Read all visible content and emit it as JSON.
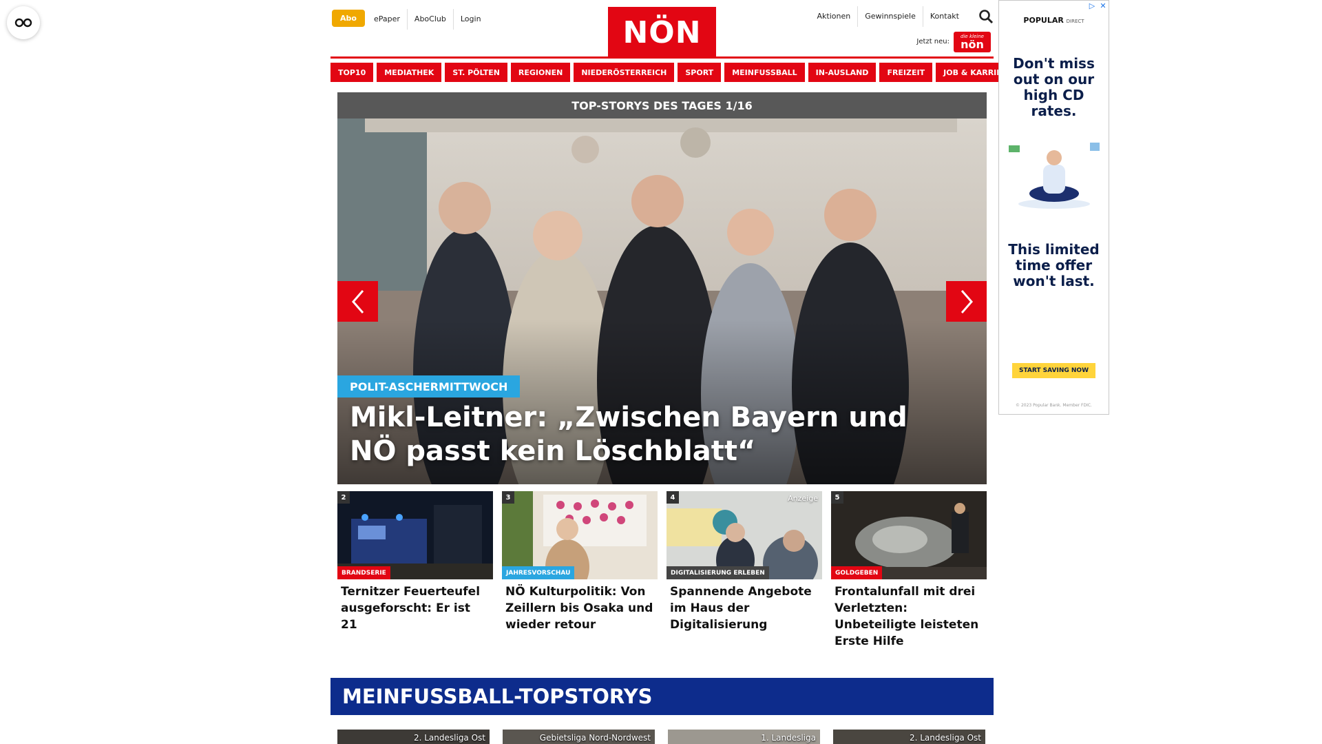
{
  "header": {
    "abo_label": "Abo",
    "left_links": [
      "ePaper",
      "AboClub",
      "Login"
    ],
    "logo_text": "NÖN",
    "right_links": [
      "Aktionen",
      "Gewinnspiele",
      "Kontakt"
    ],
    "jetzt_neu": "Jetzt neu:",
    "badge_small": "die kleine",
    "badge_big": "nön"
  },
  "nav": [
    "TOP10",
    "MEDIATHEK",
    "ST. PÖLTEN",
    "REGIONEN",
    "NIEDERÖSTERREICH",
    "SPORT",
    "MEINFUSSBALL",
    "IN-AUSLAND",
    "FREIZEIT",
    "JOB & KARRIERE"
  ],
  "hero": {
    "bar_title": "TOP-STORYS DES TAGES 1/16",
    "kicker": "POLIT-ASCHERMITTWOCH",
    "title": "Mikl-Leitner: „Zwischen Bayern und NÖ passt kein Löschblatt“"
  },
  "cards": [
    {
      "num": "2",
      "label": "BRANDSERIE",
      "label_color": "#e20613",
      "title": "Ternitzer Feuerteufel ausgeforscht: Er ist 21"
    },
    {
      "num": "3",
      "label": "JAHRESVORSCHAU",
      "label_color": "#2aa6e0",
      "title": "NÖ Kulturpolitik: Von Zeillern bis Osaka und wieder retour"
    },
    {
      "num": "4",
      "label": "DIGITALISIERUNG ERLEBEN",
      "label_color": "#444444",
      "anzeige": "Anzeige",
      "title": "Spannende Angebote im Haus der Digitalisierung"
    },
    {
      "num": "5",
      "label": "GOLDGEBEN",
      "label_color": "#e20613",
      "title": "Frontalunfall mit drei Verletzten: Unbeteiligte leisteten Erste Hilfe"
    }
  ],
  "fussball": {
    "title": "MEINFUSSBALL-TOPSTORYS",
    "tags": [
      "2. Landesliga Ost",
      "Gebietsliga Nord-Nordwest",
      "1. Landesliga",
      "2. Landesliga Ost"
    ]
  },
  "ad": {
    "logo": "POPULAR",
    "logo_sub": "DIRECT",
    "headline": "Don't miss out on our high CD rates.",
    "headline2": "This limited time offer won't last.",
    "cta": "START SAVING NOW",
    "footer": "© 2023 Popular Bank. Member FDIC."
  },
  "colors": {
    "brand_red": "#e20613",
    "abo_orange": "#f0a800",
    "fussball_blue": "#0d2c8c",
    "kicker_blue": "#2aa6e0"
  }
}
